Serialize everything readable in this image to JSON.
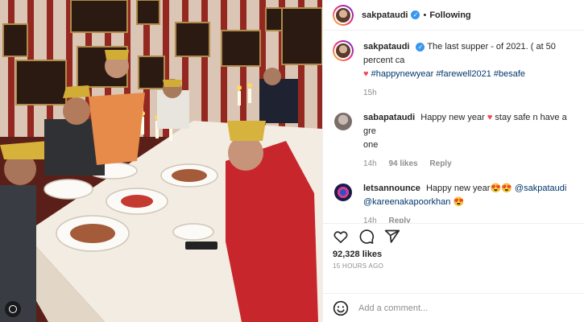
{
  "post": {
    "photo_alt": "",
    "header": {
      "username": "sakpataudi",
      "follow_status": "Following",
      "separator": "•"
    },
    "caption": {
      "username": "sakpataudi",
      "text": "The last supper - of 2021. ( at 50 percent ca",
      "hashtags": "#happynewyear #farewell2021 #besafe",
      "time": "15h"
    },
    "comments": [
      {
        "username": "sabapataudi",
        "text_before": "Happy new year",
        "text_after": "stay safe n have a gre",
        "text_line2": "one",
        "time": "14h",
        "likes": "94 likes",
        "reply": "Reply"
      },
      {
        "username": "letsannounce",
        "text": "Happy new year😍😍",
        "mention1": "@sakpataudi",
        "mention2": "@kareenakapoorkhan",
        "emoji_end": "😍",
        "time": "14h",
        "reply": "Reply"
      }
    ],
    "likes_count": "92,328 likes",
    "posted_ago": "15 HOURS AGO",
    "add_comment_placeholder": "Add a comment..."
  },
  "colors": {
    "verified": "#3897f0",
    "heart": "#ed4956",
    "muted": "#8e8e8e",
    "link": "#00376b"
  },
  "icons": [
    "verified-badge-icon",
    "heart-icon",
    "comment-icon",
    "share-icon",
    "emoji-icon",
    "reel-badge-icon"
  ]
}
